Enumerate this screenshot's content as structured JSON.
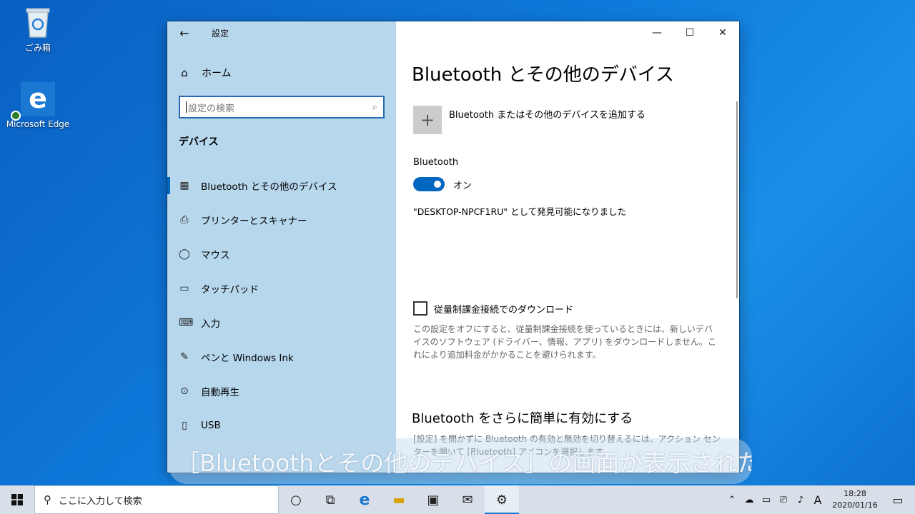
{
  "desktop": {
    "icons": [
      {
        "label": "ごみ箱",
        "icon": "recycle-bin-icon"
      },
      {
        "label": "Microsoft Edge",
        "icon": "edge-icon"
      }
    ]
  },
  "window": {
    "title": "設定",
    "back_glyph": "←",
    "controls": {
      "minimize": "—",
      "maximize": "☐",
      "close": "✕"
    }
  },
  "sidebar": {
    "home_label": "ホーム",
    "home_icon": "⌂",
    "search_placeholder": "設定の検索",
    "search_icon": "⌕",
    "section_title": "デバイス",
    "items": [
      {
        "label": "Bluetooth とその他のデバイス",
        "icon": "▦",
        "active": true
      },
      {
        "label": "プリンターとスキャナー",
        "icon": "⎙"
      },
      {
        "label": "マウス",
        "icon": "◯"
      },
      {
        "label": "タッチパッド",
        "icon": "▭"
      },
      {
        "label": "入力",
        "icon": "⌨"
      },
      {
        "label": "ペンと Windows Ink",
        "icon": "✎"
      },
      {
        "label": "自動再生",
        "icon": "⊙"
      },
      {
        "label": "USB",
        "icon": "▯"
      }
    ]
  },
  "main": {
    "title": "Bluetooth とその他のデバイス",
    "add_device_label": "Bluetooth またはその他のデバイスを追加する",
    "add_icon": "+",
    "bluetooth_label": "Bluetooth",
    "toggle_state_text": "オン",
    "toggle_on": true,
    "discoverable_text": "\"DESKTOP-NPCF1RU\" として発見可能になりました",
    "metered_label": "従量制課金接続でのダウンロード",
    "metered_checked": false,
    "metered_desc": "この設定をオフにすると、従量制課金接続を使っているときには、新しいデバイスのソフトウェア (ドライバー、情報、アプリ) をダウンロードしません。これにより追加料金がかかることを避けられます。",
    "section2_title": "Bluetooth をさらに簡単に有効にする",
    "section2_desc": "[設定] を開かずに Bluetooth の有効と無効を切り替えるには、アクション センターを開いて [Bluetooth] アイコンを選択します。"
  },
  "caption": "［Bluetoothとその他のデバイス］の画面が表示された",
  "taskbar": {
    "search_placeholder": "ここに入力して検索",
    "search_icon": "⚲",
    "apps": [
      {
        "name": "cortana-icon",
        "glyph": "○"
      },
      {
        "name": "task-view-icon",
        "glyph": "⧉"
      },
      {
        "name": "edge-icon",
        "glyph": "e"
      },
      {
        "name": "file-explorer-icon",
        "glyph": "▬"
      },
      {
        "name": "store-icon",
        "glyph": "▣"
      },
      {
        "name": "mail-icon",
        "glyph": "✉"
      },
      {
        "name": "settings-icon",
        "glyph": "⚙"
      }
    ],
    "tray": {
      "chevron": "⌃",
      "onedrive": "☁",
      "battery": "▭",
      "network": "⎚",
      "volume": "♪",
      "ime": "A"
    },
    "time": "18:28",
    "date": "2020/01/16",
    "notification_icon": "▭"
  },
  "colors": {
    "accent": "#0067c0",
    "sidebar_bg": "#b7d7ed"
  }
}
